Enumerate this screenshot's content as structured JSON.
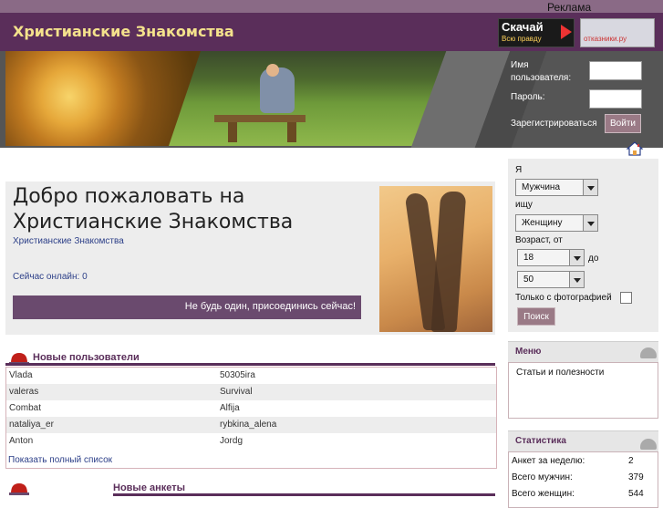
{
  "ads": {
    "label": "Реклама",
    "banner1_line1": "Скачай",
    "banner1_line2": "Всю правду",
    "banner2_text": "отказники.ру"
  },
  "header": {
    "title": "Христианские Знакомства"
  },
  "login": {
    "username_label": "Имя пользователя:",
    "password_label": "Пароль:",
    "register_link": "Зарегистрироваться",
    "login_button": "Войти"
  },
  "welcome": {
    "title": "Добро пожаловать на Христианские Знакомства",
    "subtitle": "Христианские Знакомства",
    "online": "Сейчас онлайн: 0",
    "join_text": "Не будь один,  присоединись сейчас!"
  },
  "search": {
    "i_label": "Я",
    "gender_value": "Мужчина",
    "seek_label": "ищу",
    "seek_value": "Женщину",
    "age_from_label": "Возраст, от",
    "age_from_value": "18",
    "to_label": "до",
    "age_to_value": "50",
    "photo_label": "Только с фотографией",
    "button": "Поиск"
  },
  "menu": {
    "title": "Меню",
    "items": [
      "Статьи и полезности"
    ]
  },
  "stats": {
    "title": "Статистика",
    "rows": [
      {
        "label": "Анкет за неделю:",
        "value": "2"
      },
      {
        "label": "Всего мужчин:",
        "value": "379"
      },
      {
        "label": "Всего женщин:",
        "value": "544"
      }
    ]
  },
  "new_users": {
    "title": "Новые пользователи",
    "rows": [
      [
        "Vlada",
        "50305ira"
      ],
      [
        "valeras",
        "Survival"
      ],
      [
        "Combat",
        "Alfija"
      ],
      [
        "nataliya_er",
        "rybkina_alena"
      ],
      [
        "Anton",
        "Jordg"
      ]
    ],
    "show_all": "Показать полный список"
  },
  "new_profiles": {
    "title": "Новые анкеты"
  }
}
